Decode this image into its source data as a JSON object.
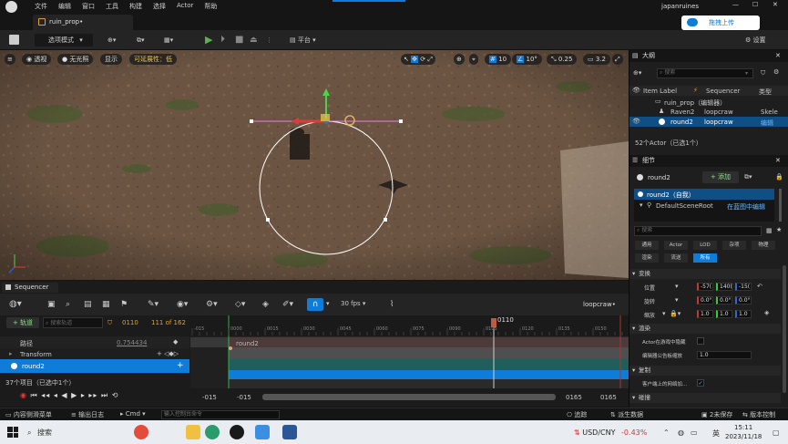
{
  "menubar": {
    "items": [
      "文件",
      "编辑",
      "窗口",
      "工具",
      "构建",
      "选择",
      "Actor",
      "帮助"
    ],
    "project": "japanruines",
    "share_btn": "拖拽上传"
  },
  "tab": {
    "title": "ruin_prop•"
  },
  "toolbar": {
    "mode": "选项模式",
    "platform": "平台",
    "settings": "设置"
  },
  "viewport": {
    "perspective": "透视",
    "lit": "无光照",
    "show": "显示",
    "scalability": "可延展性：低",
    "grid_snap": "10",
    "rot_snap": "10°",
    "scale_snap": "0.25",
    "cam_speed": "3.2"
  },
  "sequencer": {
    "tab": "Sequencer",
    "add_track": "+ 轨道",
    "search_placeholder": "搜索轨道",
    "current_frame": "0110",
    "frame_count": "111 of 162",
    "fps": "30 fps",
    "seq_name": "loopcraw•",
    "tracks": [
      {
        "name": "路径",
        "value": "0.754434"
      },
      {
        "name": "Transform",
        "value": ""
      },
      {
        "name": "round2",
        "value": ""
      }
    ],
    "clip_label": "round2",
    "status": "37个项目（已选中1个）",
    "playhead_label": "0110",
    "ruler": [
      "-015",
      "0000",
      "0015",
      "0030",
      "0045",
      "0060",
      "0075",
      "0090",
      "0105",
      "0120",
      "0135",
      "0150"
    ],
    "range_start_a": "-015",
    "range_start_b": "-015",
    "range_end_a": "0165",
    "range_end_b": "0165"
  },
  "outliner": {
    "title": "大纲",
    "search_placeholder": "搜索",
    "col_label": "Item Label",
    "col_seq": "Sequencer",
    "col_type": "类型",
    "rows": [
      {
        "label": "ruin_prop（编辑器）",
        "seq": "",
        "type": ""
      },
      {
        "label": "Raven2",
        "seq": "loopcraw",
        "type": "Skele"
      },
      {
        "label": "round2",
        "seq": "loopcraw",
        "type": "编辑"
      }
    ],
    "count": "52个Actor（已选1个）"
  },
  "details": {
    "title": "细节",
    "actor": "round2",
    "add": "+ 添加",
    "self_item": "round2（自我）",
    "root_item": "DefaultSceneRoot",
    "root_link": "在蓝图中编辑",
    "search_placeholder": "搜索",
    "filters_row1": [
      "通用",
      "Actor",
      "LOD",
      "杂项",
      "物理"
    ],
    "filters_row2": [
      "渲染",
      "流送",
      "所有"
    ],
    "sec_transform": "变换",
    "loc_label": "位置",
    "loc": [
      "-57(",
      "140(",
      "-15("
    ],
    "rot_label": "旋转",
    "rot": [
      "0.0°",
      "0.0°",
      "0.0°"
    ],
    "scale_label": "缩放",
    "scale": [
      "1.0",
      "1.0",
      "1.0"
    ],
    "sec_render": "渲染",
    "hidden_label": "Actor在游戏中隐藏",
    "billboard_label": "编辑器公告板缩放",
    "billboard_val": "1.0",
    "sec_replication": "复制",
    "net_load_label": "客户端上的网络加...",
    "sec_collision": "碰撞"
  },
  "statusbar": {
    "content_drawer": "内容侧滑菜单",
    "output_log": "输出日志",
    "cmd": "Cmd",
    "console_placeholder": "输入控制台命令",
    "trace": "追踪",
    "derived": "派生数据",
    "unsaved": "2未保存",
    "source_control": "版本控制"
  },
  "taskbar": {
    "search": "搜索",
    "ticker": "USD/CNY",
    "ticker_change": "-0.43%",
    "lang": "英",
    "time": "15:11",
    "date": "2023/11/18"
  },
  "colors": {
    "accent": "#0e7cd8",
    "play_green": "#5bb14a",
    "scalability_yellow": "#e8c34a",
    "ticker_red": "#d13438"
  }
}
